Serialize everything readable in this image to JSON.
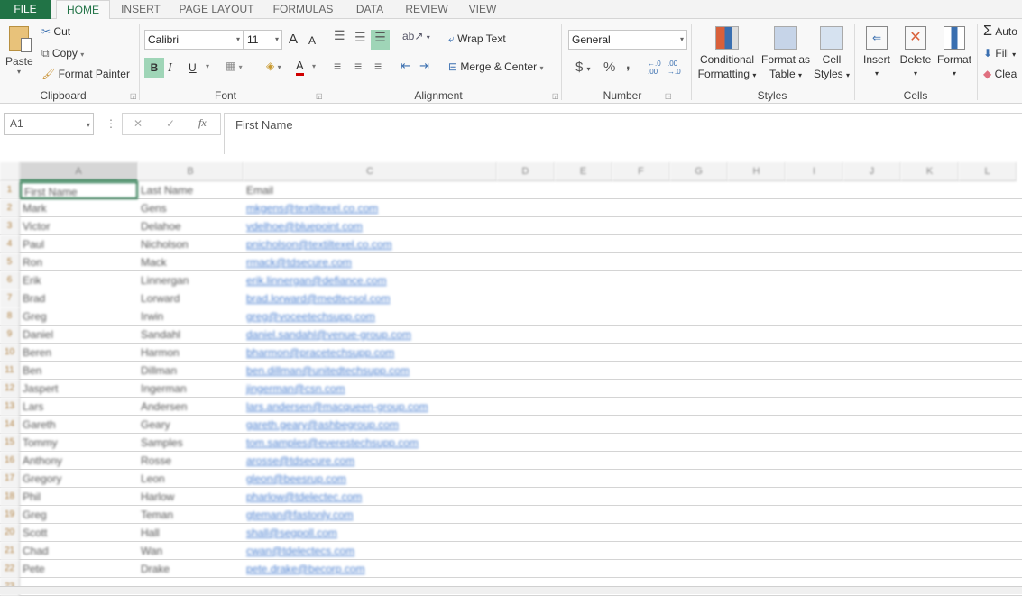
{
  "tabs": [
    "FILE",
    "HOME",
    "INSERT",
    "PAGE LAYOUT",
    "FORMULAS",
    "DATA",
    "REVIEW",
    "VIEW"
  ],
  "clipboard": {
    "paste": "Paste",
    "cut": "Cut",
    "copy": "Copy",
    "format_painter": "Format Painter",
    "label": "Clipboard"
  },
  "font": {
    "name": "Calibri",
    "size": "11",
    "bold": "B",
    "italic": "I",
    "underline": "U",
    "grow": "A",
    "shrink": "A",
    "font_color": "A",
    "label": "Font"
  },
  "alignment": {
    "wrap": "Wrap Text",
    "merge": "Merge & Center",
    "label": "Alignment"
  },
  "number": {
    "format": "General",
    "currency": "$",
    "percent": "%",
    "comma": ",",
    "inc_decimal": "←.0 .00",
    "dec_decimal": ".00 →.0",
    "label": "Number"
  },
  "styles": {
    "conditional": "Conditional",
    "conditional2": "Formatting",
    "format_table": "Format as",
    "format_table2": "Table",
    "cell_styles": "Cell",
    "cell_styles2": "Styles",
    "label": "Styles"
  },
  "cells": {
    "insert": "Insert",
    "delete": "Delete",
    "format": "Format",
    "label": "Cells"
  },
  "editing": {
    "autosum": "Auto",
    "fill": "Fill",
    "clear": "Clea"
  },
  "formula_bar": {
    "name_box": "A1",
    "fx": "fx",
    "cancel": "✕",
    "enter": "✓",
    "content": "First Name"
  },
  "columns": [
    "A",
    "B",
    "C",
    "D",
    "E",
    "F",
    "G",
    "H",
    "I",
    "J",
    "K",
    "L"
  ],
  "header_row": [
    "First Name",
    "Last Name",
    "Email"
  ],
  "rows": [
    [
      "Mark",
      "Gens",
      "mkgens@textiltexel.co.com"
    ],
    [
      "Victor",
      "Delahoe",
      "vdelhoe@bluepoint.com"
    ],
    [
      "Paul",
      "Nicholson",
      "pnicholson@textiltexel.co.com"
    ],
    [
      "Ron",
      "Mack",
      "rmack@tdsecure.com"
    ],
    [
      "Erik",
      "Linnergan",
      "erik.linnergan@defiance.com"
    ],
    [
      "Brad",
      "Lorward",
      "brad.lorward@medtecsol.com"
    ],
    [
      "Greg",
      "Irwin",
      "greg@voceetechsupp.com"
    ],
    [
      "Daniel",
      "Sandahl",
      "daniel.sandahl@venue-group.com"
    ],
    [
      "Beren",
      "Harmon",
      "bharmon@pracetechsupp.com"
    ],
    [
      "Ben",
      "Dillman",
      "ben.dillman@unitedtechsupp.com"
    ],
    [
      "Jaspert",
      "Ingerman",
      "jingerman@csn.com"
    ],
    [
      "Lars",
      "Andersen",
      "lars.andersen@macqueen-group.com"
    ],
    [
      "Gareth",
      "Geary",
      "gareth.geary@ashbegroup.com"
    ],
    [
      "Tommy",
      "Samples",
      "tom.samples@everestechsupp.com"
    ],
    [
      "Anthony",
      "Rosse",
      "arosse@tdsecure.com"
    ],
    [
      "Gregory",
      "Leon",
      "gleon@beesrup.com"
    ],
    [
      "Phil",
      "Harlow",
      "pharlow@tdelectec.com"
    ],
    [
      "Greg",
      "Teman",
      "gteman@fastonly.com"
    ],
    [
      "Scott",
      "Hall",
      "shall@segpoll.com"
    ],
    [
      "Chad",
      "Wan",
      "cwan@tdelectecs.com"
    ],
    [
      "Pete",
      "Drake",
      "pete.drake@becorp.com"
    ]
  ],
  "colors": {
    "accent": "#217346",
    "link": "#4a7fd0"
  }
}
